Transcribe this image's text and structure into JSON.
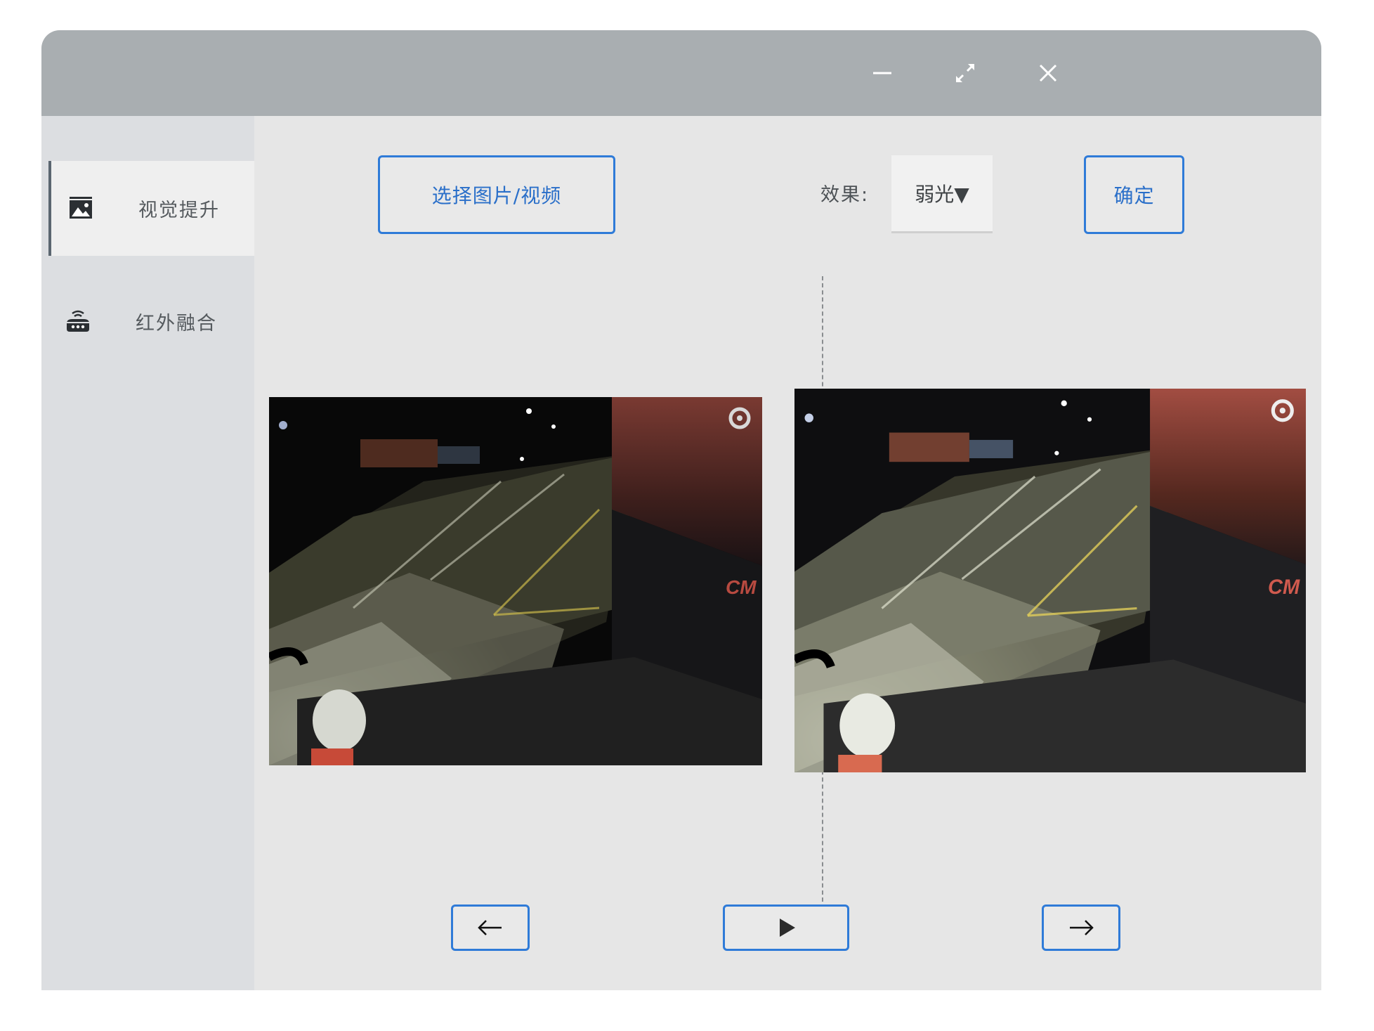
{
  "sidebar": {
    "items": [
      {
        "label": "视觉提升",
        "icon": "image-icon",
        "active": true
      },
      {
        "label": "红外融合",
        "icon": "infrared-device-icon",
        "active": false
      }
    ]
  },
  "toolbar": {
    "select_media_label": "选择图片/视频",
    "effect_label": "效果:",
    "effect_value": "弱光▼",
    "confirm_label": "确定"
  },
  "preview": {
    "original_image": "night-port-scene-original",
    "enhanced_image": "night-port-scene-enhanced"
  },
  "titlebar": {
    "controls": [
      "minimize-icon",
      "maximize-icon",
      "close-icon"
    ]
  },
  "playback": {
    "controls": [
      "arrow-left-icon",
      "play-icon",
      "arrow-right-icon"
    ]
  },
  "colors": {
    "accent": "#2f7bd8",
    "titlebar": "#a9aeb1",
    "sidebar": "#dcdee1",
    "content": "#e6e6e6"
  }
}
